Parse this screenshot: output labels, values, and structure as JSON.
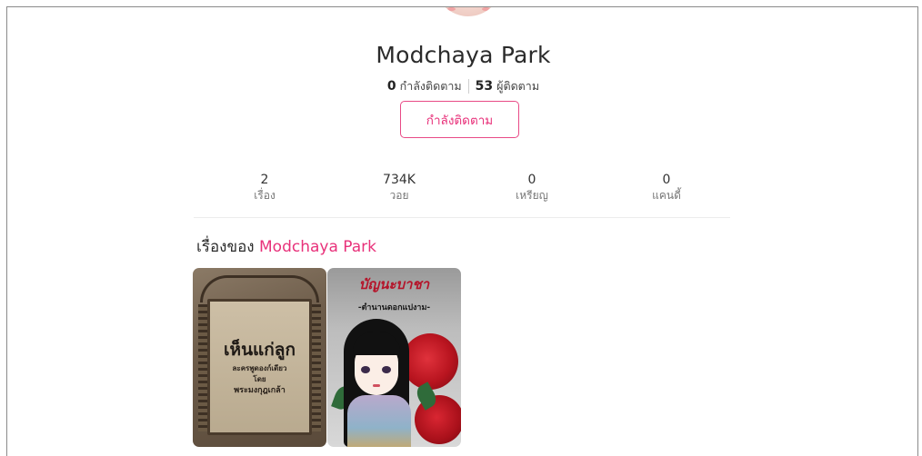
{
  "profile": {
    "name": "Modchaya Park",
    "following_count": "0",
    "following_label": "กำลังติดตาม",
    "followers_count": "53",
    "followers_label": "ผู้ติดตาม",
    "follow_button_label": "กำลังติดตาม"
  },
  "stats": [
    {
      "value": "2",
      "label": "เรื่อง"
    },
    {
      "value": "734K",
      "label": "วอย"
    },
    {
      "value": "0",
      "label": "เหรียญ"
    },
    {
      "value": "0",
      "label": "แคนดี้"
    }
  ],
  "stories_section": {
    "title_prefix": "เรื่องของ",
    "title_name": "Modchaya Park"
  },
  "stories": [
    {
      "cover_title": "เห็นแก่ลูก",
      "cover_line1": "ละครพูดองก์เดียว",
      "cover_line2": "โดย",
      "cover_line3": "พระมงกุฎเกล้า"
    },
    {
      "cover_title": "บัญนะบาชา",
      "cover_subtitle": "-ตำนานดอกแปงาม-"
    }
  ],
  "colors": {
    "accent": "#e8317a",
    "frame_border": "#8a8a8a"
  }
}
